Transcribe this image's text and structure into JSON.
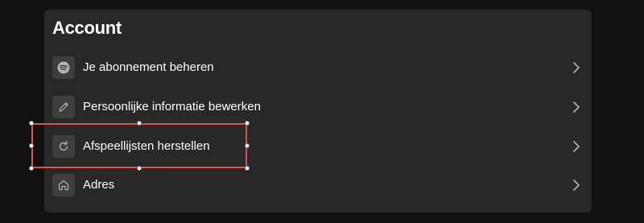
{
  "account": {
    "title": "Account",
    "items": [
      {
        "label": "Je abonnement beheren",
        "icon": "spotify-icon"
      },
      {
        "label": "Persoonlijke informatie bewerken",
        "icon": "pencil-icon"
      },
      {
        "label": "Afspeellijsten herstellen",
        "icon": "refresh-icon"
      },
      {
        "label": "Adres",
        "icon": "home-icon"
      }
    ]
  },
  "colors": {
    "page_background": "#121212",
    "card_background": "#282828",
    "icon_tile": "#3e3e3e",
    "text": "#ffffff",
    "selection_outline": "#d9534f"
  }
}
